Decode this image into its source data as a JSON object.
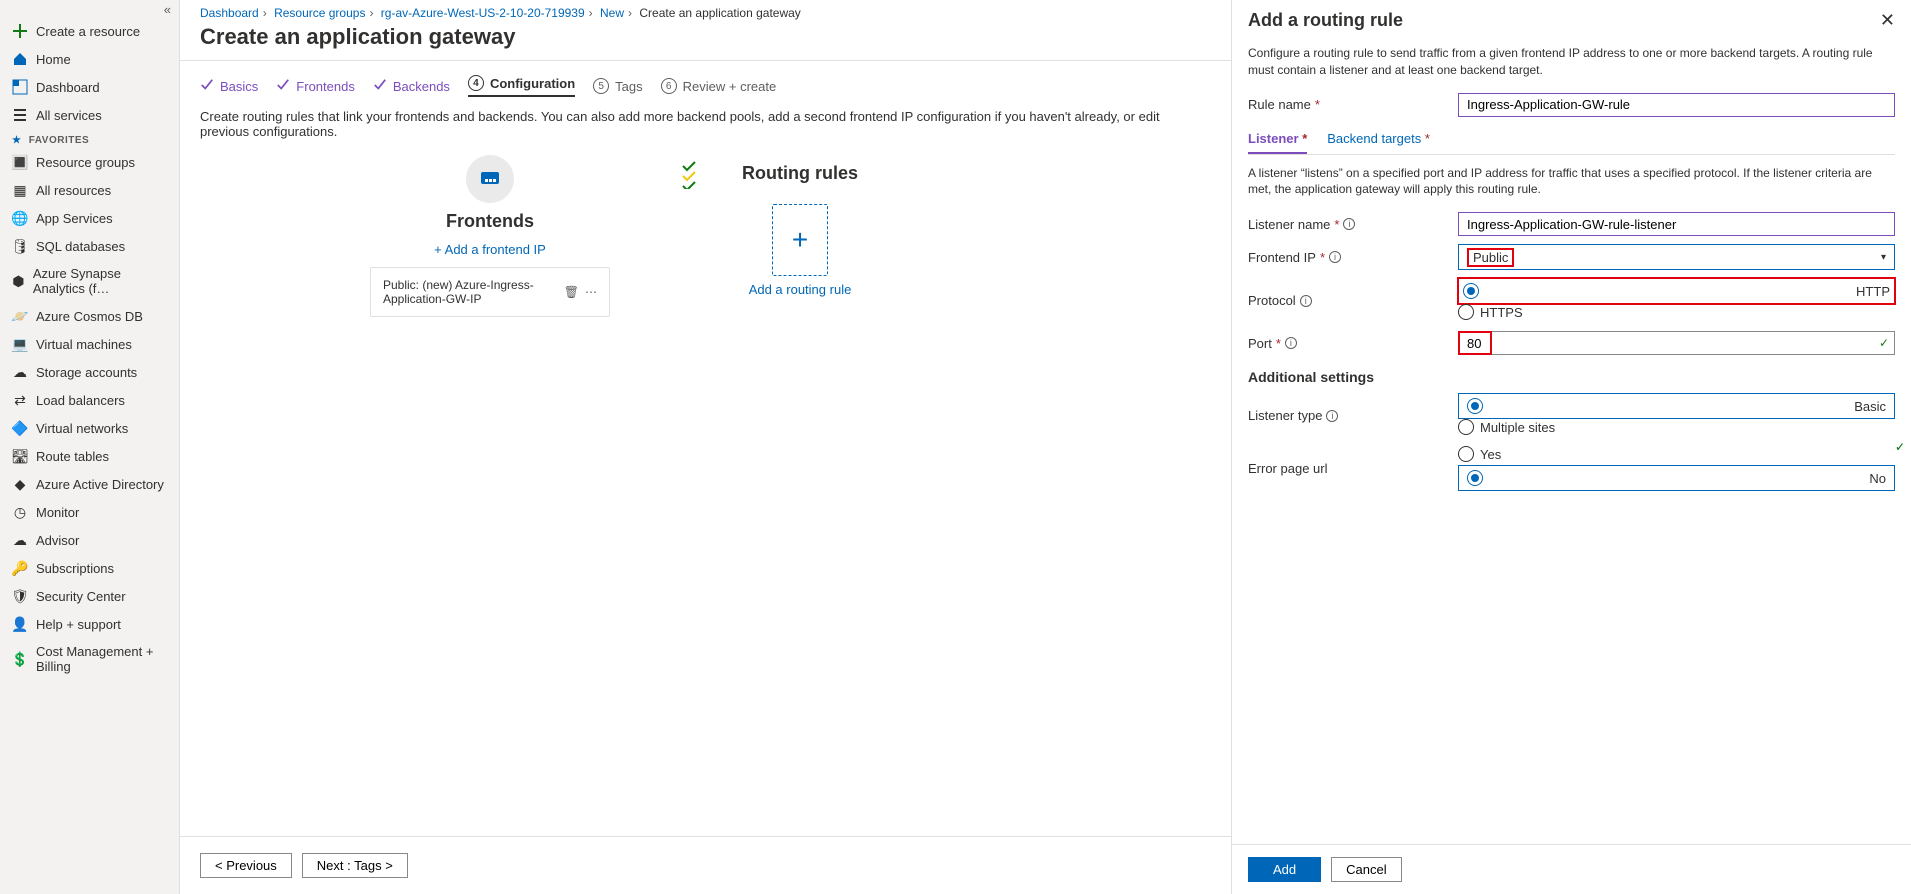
{
  "sidebar": {
    "create": "Create a resource",
    "home": "Home",
    "dashboard": "Dashboard",
    "all_services": "All services",
    "fav_hdr": "FAVORITES",
    "items": [
      "Resource groups",
      "All resources",
      "App Services",
      "SQL databases",
      "Azure Synapse Analytics (f…",
      "Azure Cosmos DB",
      "Virtual machines",
      "Storage accounts",
      "Load balancers",
      "Virtual networks",
      "Route tables",
      "Azure Active Directory",
      "Monitor",
      "Advisor",
      "Subscriptions",
      "Security Center",
      "Help + support",
      "Cost Management + Billing"
    ]
  },
  "crumbs": [
    "Dashboard",
    "Resource groups",
    "rg-av-Azure-West-US-2-10-20-719939",
    "New",
    "Create an application gateway"
  ],
  "page_title": "Create an application gateway",
  "tabs": {
    "basics": "Basics",
    "frontends": "Frontends",
    "backends": "Backends",
    "configuration": "Configuration",
    "tags": "Tags",
    "review": "Review + create"
  },
  "config_desc": "Create routing rules that link your frontends and backends. You can also add more backend pools, add a second frontend IP configuration if you haven't already, or edit previous configurations.",
  "frontends": {
    "title": "Frontends",
    "add": "+ Add a frontend IP",
    "item": "Public: (new) Azure-Ingress-Application-GW-IP"
  },
  "routing": {
    "title": "Routing rules",
    "add": "Add a routing rule"
  },
  "footer": {
    "prev": "< Previous",
    "next": "Next : Tags >"
  },
  "blade": {
    "title": "Add a routing rule",
    "help1": "Configure a routing rule to send traffic from a given frontend IP address to one or more backend targets. A routing rule must contain a listener and at least one backend target.",
    "rule_name_lbl": "Rule name",
    "rule_name_val": "Ingress-Application-GW-rule",
    "tab_listener": "Listener",
    "tab_backend": "Backend targets",
    "help2": "A listener “listens” on a specified port and IP address for traffic that uses a specified protocol. If the listener criteria are met, the application gateway will apply this routing rule.",
    "listener_name_lbl": "Listener name",
    "listener_name_val": "Ingress-Application-GW-rule-listener",
    "frontend_ip_lbl": "Frontend IP",
    "frontend_ip_val": "Public",
    "protocol_lbl": "Protocol",
    "protocol_http": "HTTP",
    "protocol_https": "HTTPS",
    "port_lbl": "Port",
    "port_val": "80",
    "additional_hdr": "Additional settings",
    "listener_type_lbl": "Listener type",
    "lt_basic": "Basic",
    "lt_multi": "Multiple sites",
    "err_url_lbl": "Error page url",
    "err_yes": "Yes",
    "err_no": "No",
    "add_btn": "Add",
    "cancel_btn": "Cancel"
  }
}
